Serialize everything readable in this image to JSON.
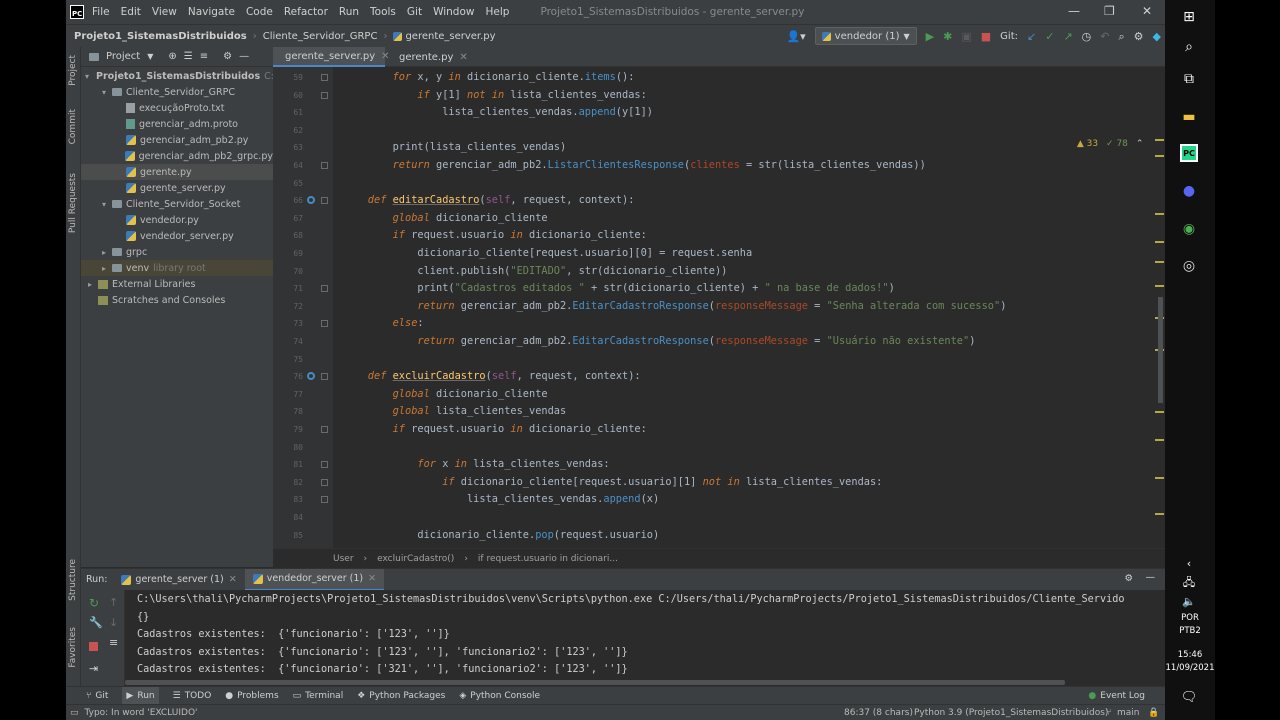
{
  "app": {
    "logo": "PC",
    "menu": [
      "File",
      "Edit",
      "View",
      "Navigate",
      "Code",
      "Refactor",
      "Run",
      "Tools",
      "Git",
      "Window",
      "Help"
    ],
    "window_title": "Projeto1_SistemasDistribuidos - gerente_server.py"
  },
  "navbar": {
    "crumbs": [
      "Projeto1_SistemasDistribuidos",
      "Cliente_Servidor_GRPC",
      "gerente_server.py"
    ],
    "run_config": "vendedor (1)",
    "git_label": "Git:"
  },
  "project": {
    "header": "Project",
    "tree": [
      {
        "label": "Projeto1_SistemasDistribuidos",
        "extra": "C:\\U",
        "type": "folder",
        "indent": 0,
        "arrow": "▾"
      },
      {
        "label": "Cliente_Servidor_GRPC",
        "type": "folder",
        "indent": 1,
        "arrow": "▾"
      },
      {
        "label": "execuçãoProto.txt",
        "type": "txt",
        "indent": 2
      },
      {
        "label": "gerenciar_adm.proto",
        "type": "proto",
        "indent": 2
      },
      {
        "label": "gerenciar_adm_pb2.py",
        "type": "py",
        "indent": 2
      },
      {
        "label": "gerenciar_adm_pb2_grpc.py",
        "type": "py",
        "indent": 2
      },
      {
        "label": "gerente.py",
        "type": "py",
        "indent": 2,
        "selected": true
      },
      {
        "label": "gerente_server.py",
        "type": "py",
        "indent": 2
      },
      {
        "label": "Cliente_Servidor_Socket",
        "type": "folder",
        "indent": 1,
        "arrow": "▾"
      },
      {
        "label": "vendedor.py",
        "type": "py",
        "indent": 2
      },
      {
        "label": "vendedor_server.py",
        "type": "py",
        "indent": 2
      },
      {
        "label": "grpc",
        "type": "folder",
        "indent": 1,
        "arrow": "▸"
      },
      {
        "label": "venv",
        "extra": "library root",
        "type": "folder",
        "indent": 1,
        "arrow": "▸",
        "highlight": true
      },
      {
        "label": "External Libraries",
        "type": "lib",
        "indent": 0,
        "arrow": "▸"
      },
      {
        "label": "Scratches and Consoles",
        "type": "lib",
        "indent": 0
      }
    ]
  },
  "left_stripe": [
    "Project",
    "Commit",
    "Pull Requests",
    "Structure",
    "Favorites"
  ],
  "editor": {
    "tabs": [
      "gerente_server.py",
      "gerente.py"
    ],
    "inspections": {
      "warnings": "▲ 33",
      "ok": "✓ 78"
    },
    "lines": [
      {
        "n": "59",
        "t": [
          [
            "kw",
            "        for "
          ],
          [
            "plain",
            "x, y "
          ],
          [
            "kw",
            "in "
          ],
          [
            "plain",
            "dicionario_cliente."
          ],
          [
            "method",
            "items"
          ],
          [
            "plain",
            "():"
          ]
        ]
      },
      {
        "n": "60",
        "t": [
          [
            "kw",
            "            if "
          ],
          [
            "plain",
            "y[1] "
          ],
          [
            "kw",
            "not in "
          ],
          [
            "plain",
            "lista_clientes_vendas:"
          ]
        ]
      },
      {
        "n": "61",
        "t": [
          [
            "plain",
            "                lista_clientes_vendas."
          ],
          [
            "method",
            "append"
          ],
          [
            "plain",
            "(y[1])"
          ]
        ]
      },
      {
        "n": "62",
        "t": [
          [
            "plain",
            ""
          ]
        ]
      },
      {
        "n": "63",
        "t": [
          [
            "plain",
            "        "
          ],
          [
            "plain",
            "print(lista_clientes_vendas)"
          ]
        ]
      },
      {
        "n": "64",
        "t": [
          [
            "kw",
            "        return "
          ],
          [
            "plain",
            "gerenciar_adm_pb2."
          ],
          [
            "method",
            "ListarClientesResponse"
          ],
          [
            "plain",
            "("
          ],
          [
            "param",
            "clientes"
          ],
          [
            "plain",
            " = str(lista_clientes_vendas))"
          ]
        ]
      },
      {
        "n": "65",
        "t": [
          [
            "plain",
            ""
          ]
        ]
      },
      {
        "n": "66",
        "t": [
          [
            "kw",
            "    def "
          ],
          [
            "fn",
            "editarCadastro"
          ],
          [
            "plain",
            "("
          ],
          [
            "self",
            "self"
          ],
          [
            "plain",
            ", request, context):"
          ]
        ]
      },
      {
        "n": "67",
        "t": [
          [
            "kw",
            "        global "
          ],
          [
            "plain",
            "dicionario_cliente"
          ]
        ]
      },
      {
        "n": "68",
        "t": [
          [
            "kw",
            "        if "
          ],
          [
            "plain",
            "request.usuario "
          ],
          [
            "kw",
            "in "
          ],
          [
            "plain",
            "dicionario_cliente:"
          ]
        ]
      },
      {
        "n": "69",
        "t": [
          [
            "plain",
            "            dicionario_cliente[request.usuario][0] = request.senha"
          ]
        ]
      },
      {
        "n": "70",
        "t": [
          [
            "plain",
            "            client.publish("
          ],
          [
            "str",
            "\"EDITADO\""
          ],
          [
            "plain",
            ", str(dicionario_cliente))"
          ]
        ]
      },
      {
        "n": "71",
        "t": [
          [
            "plain",
            "            print("
          ],
          [
            "str",
            "\"Cadastros editados \""
          ],
          [
            "plain",
            " + str(dicionario_cliente) + "
          ],
          [
            "str",
            "\" na base de dados!\""
          ],
          [
            "plain",
            ")"
          ]
        ]
      },
      {
        "n": "72",
        "t": [
          [
            "kw",
            "            return "
          ],
          [
            "plain",
            "gerenciar_adm_pb2."
          ],
          [
            "method",
            "EditarCadastroResponse"
          ],
          [
            "plain",
            "("
          ],
          [
            "param",
            "responseMessage"
          ],
          [
            "plain",
            " = "
          ],
          [
            "str",
            "\"Senha alterada com sucesso\""
          ],
          [
            "plain",
            ")"
          ]
        ]
      },
      {
        "n": "73",
        "t": [
          [
            "kw",
            "        else"
          ],
          [
            "plain",
            ":"
          ]
        ]
      },
      {
        "n": "74",
        "t": [
          [
            "kw",
            "            return "
          ],
          [
            "plain",
            "gerenciar_adm_pb2."
          ],
          [
            "method",
            "EditarCadastroResponse"
          ],
          [
            "plain",
            "("
          ],
          [
            "param",
            "responseMessage"
          ],
          [
            "plain",
            " = "
          ],
          [
            "str",
            "\"Usuário não existente\""
          ],
          [
            "plain",
            ")"
          ]
        ]
      },
      {
        "n": "75",
        "t": [
          [
            "plain",
            ""
          ]
        ]
      },
      {
        "n": "76",
        "t": [
          [
            "kw",
            "    def "
          ],
          [
            "fn",
            "excluirCadastro"
          ],
          [
            "plain",
            "("
          ],
          [
            "self",
            "self"
          ],
          [
            "plain",
            ", request, context):"
          ]
        ]
      },
      {
        "n": "77",
        "t": [
          [
            "kw",
            "        global "
          ],
          [
            "plain",
            "dicionario_cliente"
          ]
        ]
      },
      {
        "n": "78",
        "t": [
          [
            "kw",
            "        global "
          ],
          [
            "plain",
            "lista_clientes_vendas"
          ]
        ]
      },
      {
        "n": "79",
        "t": [
          [
            "kw",
            "        if "
          ],
          [
            "plain",
            "request.usuario "
          ],
          [
            "kw",
            "in "
          ],
          [
            "plain",
            "dicionario_cliente:"
          ]
        ]
      },
      {
        "n": "80",
        "t": [
          [
            "plain",
            ""
          ]
        ]
      },
      {
        "n": "81",
        "t": [
          [
            "kw",
            "            for "
          ],
          [
            "plain",
            "x "
          ],
          [
            "kw",
            "in "
          ],
          [
            "plain",
            "lista_clientes_vendas:"
          ]
        ]
      },
      {
        "n": "82",
        "t": [
          [
            "kw",
            "                if "
          ],
          [
            "plain",
            "dicionario_cliente[request.usuario][1] "
          ],
          [
            "kw",
            "not in "
          ],
          [
            "plain",
            "lista_clientes_vendas:"
          ]
        ]
      },
      {
        "n": "83",
        "t": [
          [
            "plain",
            "                    lista_clientes_vendas."
          ],
          [
            "method",
            "append"
          ],
          [
            "plain",
            "(x)"
          ]
        ]
      },
      {
        "n": "84",
        "t": [
          [
            "plain",
            ""
          ]
        ]
      },
      {
        "n": "85",
        "t": [
          [
            "plain",
            "            dicionario_cliente."
          ],
          [
            "method",
            "pop"
          ],
          [
            "plain",
            "(request.usuario)"
          ]
        ]
      }
    ],
    "breadcrumb": [
      "User",
      "excluirCadastro()",
      "if request.usuario in dicionari..."
    ]
  },
  "run": {
    "label": "Run:",
    "tabs": [
      "gerente_server (1)",
      "vendedor_server (1)"
    ],
    "console": [
      "C:\\Users\\thali\\PycharmProjects\\Projeto1_SistemasDistribuidos\\venv\\Scripts\\python.exe C:/Users/thali/PycharmProjects/Projeto1_SistemasDistribuidos/Cliente_Servido",
      "{}",
      "Cadastros existentes:  {'funcionario': ['123', '']}",
      "Cadastros existentes:  {'funcionario': ['123', ''], 'funcionario2': ['123', '']}",
      "Cadastros existentes:  {'funcionario': ['321', ''], 'funcionario2': ['123', '']}"
    ]
  },
  "bottom_tools": [
    "Git",
    "Run",
    "TODO",
    "Problems",
    "Terminal",
    "Python Packages",
    "Python Console"
  ],
  "event_log": "Event Log",
  "status": {
    "message": "Typo: In word 'EXCLUIDO'",
    "position": "86:37 (8 chars)",
    "interpreter": "Python 3.9 (Projeto1_SistemasDistribuidos)",
    "branch": "main"
  },
  "taskbar": {
    "lang": "POR",
    "layout": "PTB2",
    "time": "15:46",
    "date": "11/09/2021"
  }
}
